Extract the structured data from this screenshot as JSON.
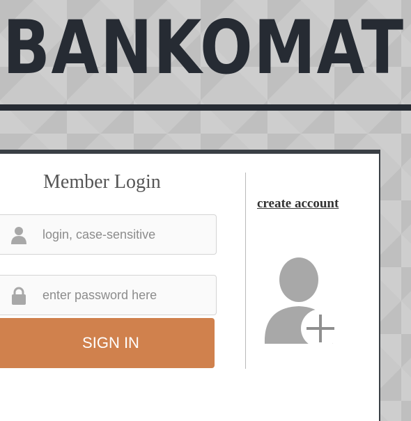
{
  "header": {
    "brand": "BANKOMAT"
  },
  "login_form": {
    "title": "Member Login",
    "login_field": {
      "placeholder": "login, case-sensitive",
      "value": "",
      "icon": "user-icon"
    },
    "password_field": {
      "placeholder": "enter password here",
      "value": "",
      "icon": "lock-icon"
    },
    "sign_in_label": "SIGN IN"
  },
  "register": {
    "link_label": "create account",
    "icon": "add-user-icon"
  },
  "colors": {
    "brand": "#262b33",
    "button": "#d0814d",
    "icon": "#a8a8a8"
  }
}
